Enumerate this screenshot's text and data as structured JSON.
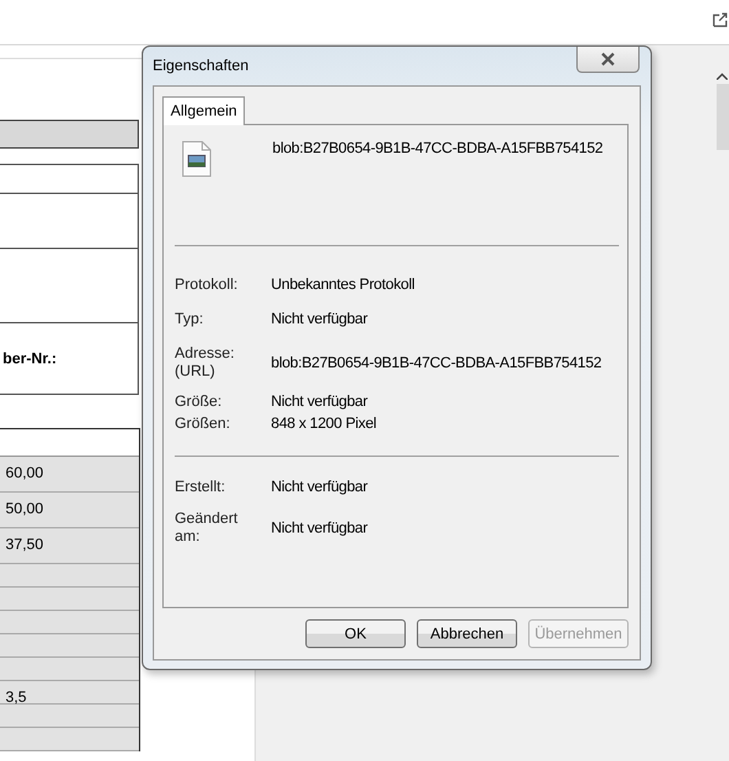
{
  "document": {
    "label": "ber-Nr.:",
    "rows": [
      {
        "amount": "60,00"
      },
      {
        "amount": "50,00"
      },
      {
        "amount": "37,50"
      },
      {},
      {},
      {},
      {},
      {},
      {
        "amount": "3,5"
      },
      {},
      {}
    ]
  },
  "dialog": {
    "title": "Eigenschaften",
    "tabs": [
      {
        "label": "Allgemein",
        "selected": true
      }
    ],
    "file_name": "blob:B27B0654-9B1B-47CC-BDBA-A15FBB754152",
    "groups": [
      [
        {
          "label": "Protokoll:",
          "value": "Unbekanntes Protokoll"
        },
        {
          "label": "Typ:",
          "value": "Nicht verfügbar"
        },
        {
          "label": "Adresse:\n(URL)",
          "value": "blob:B27B0654-9B1B-47CC-BDBA-A15FBB754152"
        },
        {
          "label": "Größe:",
          "value": "Nicht verfügbar"
        },
        {
          "label": "Größen:",
          "value": "848  x  1200  Pixel"
        }
      ],
      [
        {
          "label": "Erstellt:",
          "value": "Nicht verfügbar"
        },
        {
          "label": "Geändert\nam:",
          "value": "Nicht verfügbar"
        }
      ]
    ],
    "buttons": [
      {
        "label": "OK",
        "disabled": false
      },
      {
        "label": "Abbrechen",
        "disabled": false
      },
      {
        "label": "Übernehmen",
        "disabled": true
      }
    ]
  }
}
